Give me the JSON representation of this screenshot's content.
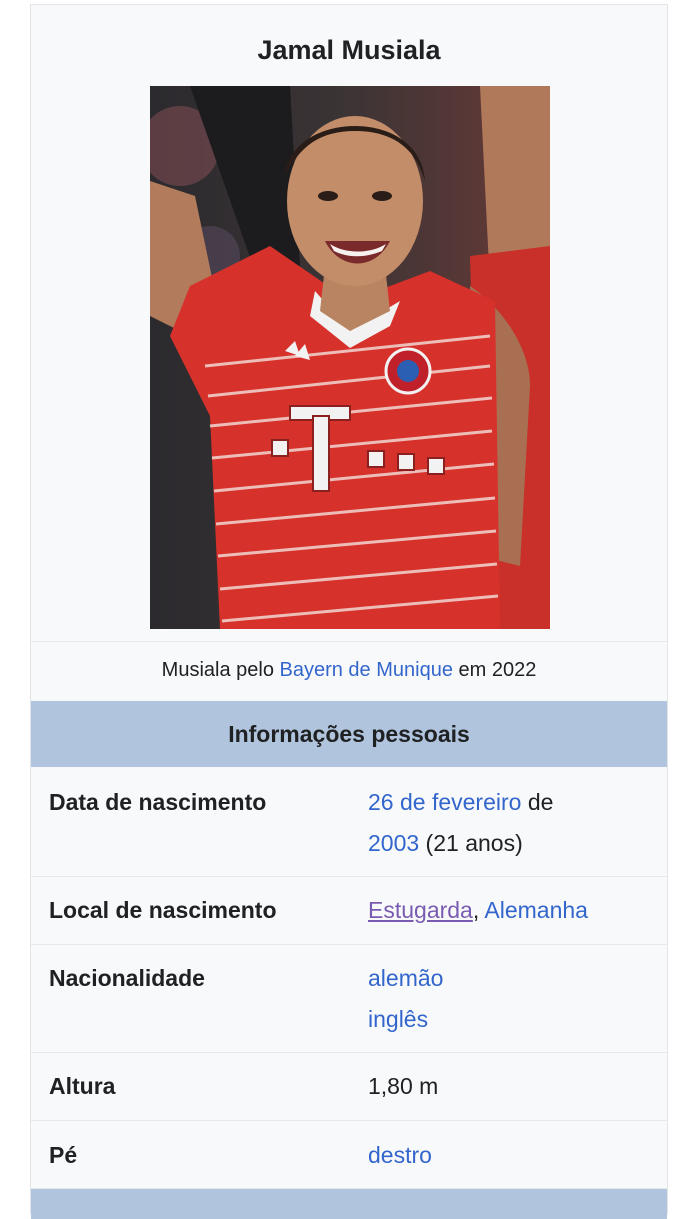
{
  "infobox": {
    "title": "Jamal Musiala",
    "caption": {
      "prefix": "Musiala pelo ",
      "link": "Bayern de Munique",
      "suffix": " em 2022"
    },
    "photo_alt": "Jamal Musiala in Bayern Munich red jersey",
    "section_header": "Informações pessoais",
    "rows": [
      {
        "label": "Data de nascimento",
        "value_link1": "26 de fevereiro",
        "value_text1": " de",
        "value_link2": "2003",
        "value_text2": " (21 anos)"
      },
      {
        "label": "Local de nascimento",
        "value_link1": "Estugarda",
        "value_text1": ", ",
        "value_link2": "Alemanha"
      },
      {
        "label": "Nacionalidade",
        "value_line1": "alemão",
        "value_line2": "inglês"
      },
      {
        "label": "Altura",
        "value": "1,80 m"
      },
      {
        "label": "Pé",
        "value": "destro"
      }
    ]
  },
  "colors": {
    "link": "#3366cc",
    "visited_link": "#795cb2",
    "header_band": "#b0c4de",
    "panel_bg": "#f8f9fa"
  }
}
